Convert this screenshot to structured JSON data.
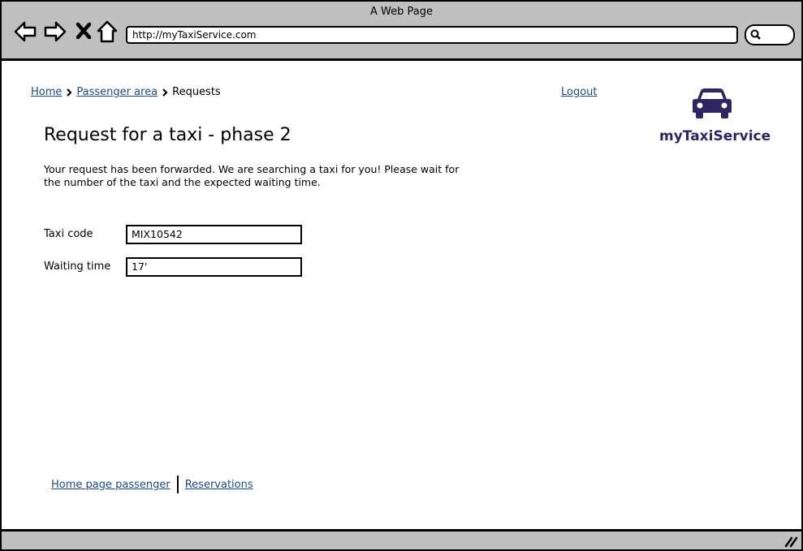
{
  "window": {
    "title": "A Web Page"
  },
  "toolbar": {
    "icons": [
      "back-icon",
      "forward-icon",
      "stop-icon",
      "home-icon"
    ],
    "url": "http://myTaxiService.com"
  },
  "breadcrumb": {
    "home": "Home",
    "passenger_area": "Passenger area",
    "current": "Requests"
  },
  "header": {
    "logout": "Logout"
  },
  "logo": {
    "text": "myTaxiService",
    "color": "#2e2660"
  },
  "main": {
    "title": "Request for a taxi - phase 2",
    "message": "Your request has been forwarded. We are searching a taxi for you! Please wait for the number of the taxi and the expected waiting time.",
    "fields": [
      {
        "label": "Taxi code",
        "value": "MIX10542"
      },
      {
        "label": "Waiting time",
        "value": "17'"
      }
    ]
  },
  "footer": {
    "home_page_passenger": "Home page passenger",
    "reservations": "Reservations"
  },
  "colors": {
    "chrome": "#c0c0c0",
    "link": "#1a4a8c"
  }
}
